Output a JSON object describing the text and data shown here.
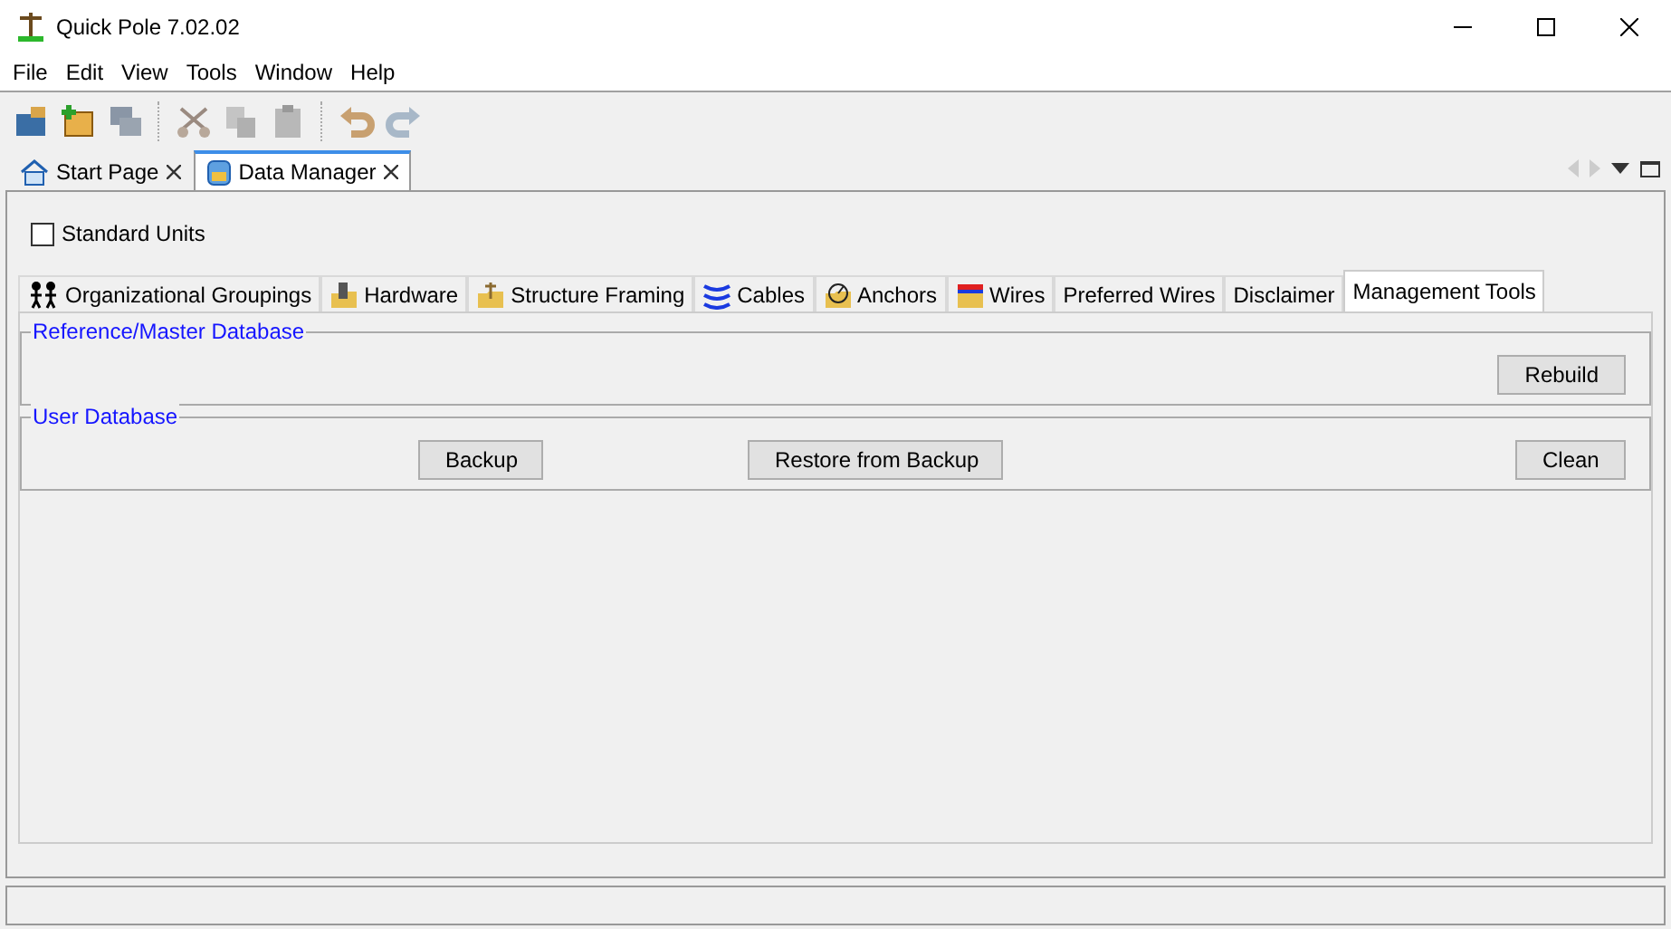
{
  "window": {
    "title": "Quick Pole 7.02.02"
  },
  "menu": [
    "File",
    "Edit",
    "View",
    "Tools",
    "Window",
    "Help"
  ],
  "doc_tabs": [
    {
      "label": "Start Page",
      "selected": false
    },
    {
      "label": "Data Manager",
      "selected": true
    }
  ],
  "standard_units": {
    "label": "Standard Units",
    "checked": false
  },
  "tabs": [
    {
      "label": "Organizational Groupings",
      "selected": false
    },
    {
      "label": "Hardware",
      "selected": false
    },
    {
      "label": "Structure Framing",
      "selected": false
    },
    {
      "label": "Cables",
      "selected": false
    },
    {
      "label": "Anchors",
      "selected": false
    },
    {
      "label": "Wires",
      "selected": false
    },
    {
      "label": "Preferred Wires",
      "selected": false
    },
    {
      "label": "Disclaimer",
      "selected": false
    },
    {
      "label": "Management Tools",
      "selected": true
    }
  ],
  "groups": [
    {
      "title": "Reference/Master Database",
      "buttons": [
        "Rebuild"
      ]
    },
    {
      "title": "User Database",
      "buttons": [
        "Backup",
        "Restore from Backup",
        "Clean"
      ]
    }
  ]
}
